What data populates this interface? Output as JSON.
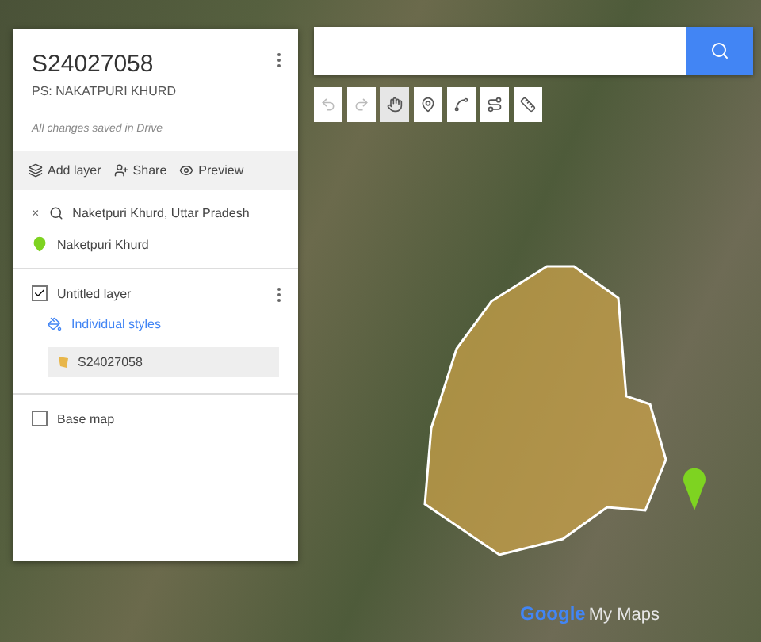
{
  "map_header": {
    "title": "S24027058",
    "subtitle": "PS: NAKATPURI KHURD",
    "save_status": "All changes saved in Drive"
  },
  "actions": [
    {
      "kind": "layer",
      "label": "Add layer"
    },
    {
      "kind": "share",
      "label": "Share"
    },
    {
      "kind": "preview",
      "label": "Preview"
    }
  ],
  "search_result": {
    "close": "×",
    "query": "Naketpuri Khurd, Uttar Pradesh",
    "place": "Naketpuri Khurd"
  },
  "layer": {
    "name": "Untitled layer",
    "checked": true,
    "style": "Individual styles",
    "feature": "S24027058"
  },
  "base_map": {
    "label": "Base map",
    "checked": false
  },
  "toolbar": [
    {
      "kind": "undo",
      "disabled": true
    },
    {
      "kind": "redo",
      "disabled": true
    },
    {
      "kind": "hand",
      "selected": true
    },
    {
      "kind": "marker",
      "selected": false
    },
    {
      "kind": "line",
      "selected": false
    },
    {
      "kind": "route",
      "selected": false
    },
    {
      "kind": "ruler",
      "selected": false
    }
  ],
  "logo": {
    "brand": "Google",
    "product": "My Maps"
  }
}
